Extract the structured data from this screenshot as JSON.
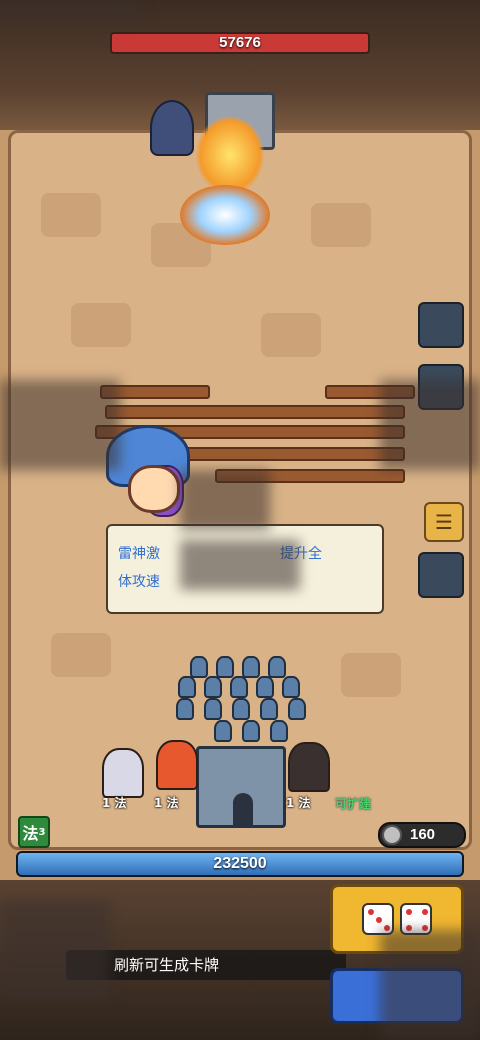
{
  "enemy": {
    "hp": "57676"
  },
  "dialog": {
    "line1": "雷神激",
    "line1_end": "提升全",
    "line2": "体攻速"
  },
  "units": [
    {
      "level": "1",
      "class": "法"
    },
    {
      "level": "1",
      "class": "法"
    },
    {
      "level": "1",
      "class": "法"
    }
  ],
  "expand_label": "可扩建",
  "class_badge": {
    "label": "法",
    "count": "3"
  },
  "coins": "160",
  "player": {
    "hp": "232500",
    "hp_fill": 1.0
  },
  "refresh_hint": "刷新可生成卡牌",
  "icons": {
    "chat": "chat-icon",
    "coin": "coin-icon",
    "dice": "dice-icon"
  },
  "colors": {
    "enemy_hp": "#c93a36",
    "player_hp": "#4f95d8",
    "dialog_text": "#2f6fd0",
    "expand_text": "#4bd06a"
  }
}
